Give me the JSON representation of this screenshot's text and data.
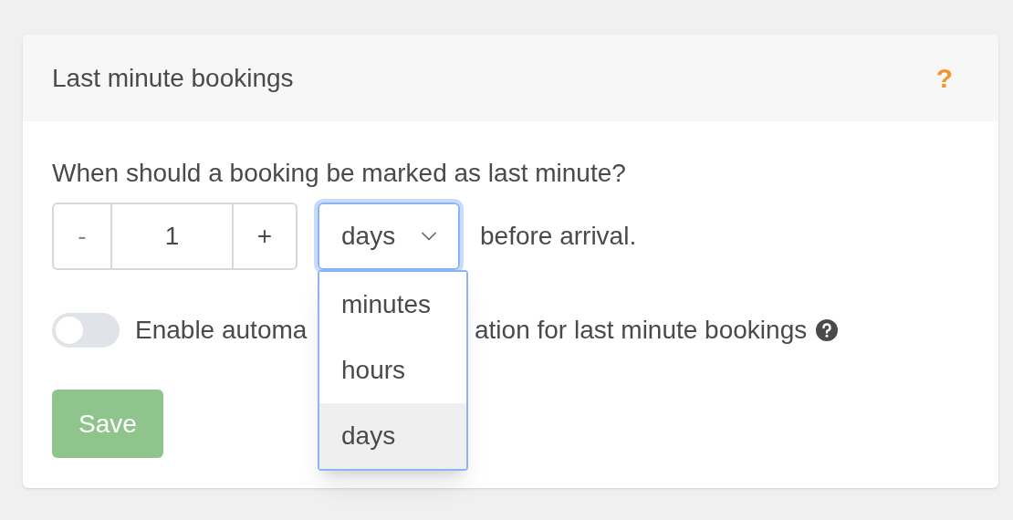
{
  "card": {
    "title": "Last minute bookings",
    "help": "?"
  },
  "question": "When should a booking be marked as last minute?",
  "stepper": {
    "minus": "-",
    "value": "1",
    "plus": "+"
  },
  "unit_select": {
    "value": "days",
    "open": true,
    "options": [
      {
        "label": "minutes",
        "selected": false
      },
      {
        "label": "hours",
        "selected": false
      },
      {
        "label": "days",
        "selected": true
      }
    ]
  },
  "suffix": "before arrival.",
  "toggle": {
    "on": false,
    "label_start": "Enable automa",
    "label_end": "ation for last minute bookings"
  },
  "save_button": {
    "label": "Save",
    "disabled": true
  }
}
